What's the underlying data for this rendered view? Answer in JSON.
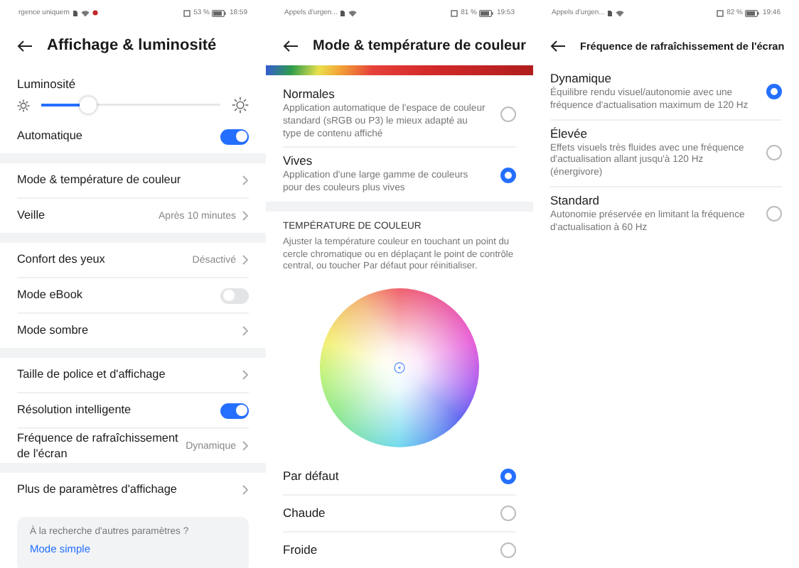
{
  "display_screen": {
    "status_bar": {
      "carrier": "rgence uniquem",
      "battery": "53 %",
      "time": "18:59"
    },
    "title": "Affichage & luminosité",
    "brightness": {
      "label": "Luminosité",
      "level": 0.26
    },
    "sections": [
      [
        {
          "kind": "toggle",
          "label": "Automatique",
          "on": true
        }
      ],
      [
        {
          "kind": "link",
          "label": "Mode & température de couleur"
        },
        {
          "kind": "link",
          "label": "Veille",
          "value": "Après 10 minutes"
        }
      ],
      [
        {
          "kind": "link",
          "label": "Confort des yeux",
          "value": "Désactivé"
        },
        {
          "kind": "toggle",
          "label": "Mode eBook",
          "on": false
        },
        {
          "kind": "link",
          "label": "Mode sombre"
        }
      ],
      [
        {
          "kind": "link",
          "label": "Taille de police et d'affichage"
        },
        {
          "kind": "toggle",
          "label": "Résolution intelligente",
          "on": true
        },
        {
          "kind": "link",
          "label": "Fréquence de rafraîchissement de l'écran",
          "value": "Dynamique"
        }
      ],
      [
        {
          "kind": "link",
          "label": "Plus de paramètres d'affichage"
        }
      ]
    ],
    "help_card": {
      "question": "À la recherche d'autres paramètres ?",
      "link": "Mode simple"
    }
  },
  "color_screen": {
    "status_bar": {
      "carrier": "Appels d'urgen...",
      "battery": "81 %",
      "time": "19:53"
    },
    "title": "Mode & température de couleur",
    "modes": [
      {
        "title": "Normales",
        "description": "Application automatique de l'espace de couleur standard (sRGB ou P3) le mieux adapté au type de contenu affiché",
        "selected": false
      },
      {
        "title": "Vives",
        "description": "Application d'une large gamme de couleurs pour des couleurs plus vives",
        "selected": true
      }
    ],
    "temperature": {
      "heading": "TEMPÉRATURE DE COULEUR",
      "description": "Ajuster la température couleur en touchant un point du cercle chromatique ou en déplaçant le point de contrôle central, ou toucher Par défaut pour réinitialiser.",
      "presets": [
        {
          "label": "Par défaut",
          "selected": true
        },
        {
          "label": "Chaude",
          "selected": false
        },
        {
          "label": "Froide",
          "selected": false
        }
      ]
    }
  },
  "refresh_screen": {
    "status_bar": {
      "carrier": "Appels d'urgen...",
      "battery": "82 %",
      "time": "19:46"
    },
    "title": "Fréquence de rafraîchissement de l'écran",
    "options": [
      {
        "title": "Dynamique",
        "description": "Équilibre rendu visuel/autonomie avec une fréquence d'actualisation maximum de 120 Hz",
        "selected": true
      },
      {
        "title": "Élevée",
        "description": "Effets visuels très fluides avec une fréquence d'actualisation allant jusqu'à 120 Hz (énergivore)",
        "selected": false
      },
      {
        "title": "Standard",
        "description": "Autonomie préservée en limitant la fréquence d'actualisation à 60 Hz",
        "selected": false
      }
    ]
  }
}
